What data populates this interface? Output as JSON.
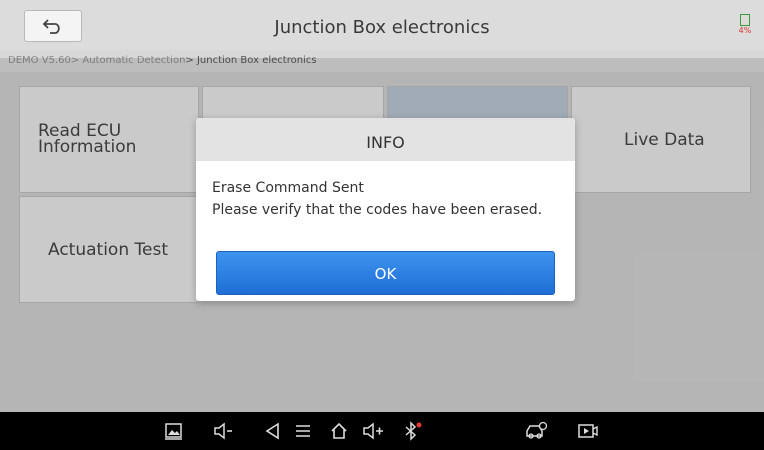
{
  "header": {
    "title": "Junction Box electronics",
    "battery_level": "4%"
  },
  "breadcrumb": {
    "path": "DEMO V5.60> Automatic Detection",
    "current": "> Junction Box electronics"
  },
  "tiles": [
    {
      "label_line1": "Read ECU",
      "label_line2": "Information"
    },
    {
      "label": "Live Data"
    },
    {
      "label": "Actuation Test"
    }
  ],
  "dialog": {
    "title": "INFO",
    "line1": "Erase Command Sent",
    "line2": "Please verify that the codes have been erased.",
    "ok_label": "OK"
  },
  "navbar": {
    "icons": [
      "screenshot-icon",
      "volume-down-icon",
      "back-nav-icon",
      "menu-icon",
      "home-icon",
      "volume-up-icon",
      "bluetooth-icon",
      "vehicle-icon",
      "screen-record-icon"
    ]
  },
  "colors": {
    "accent": "#2a7fe2",
    "tile_selected": "#b7c3d1",
    "battery_text": "#dd3333"
  }
}
